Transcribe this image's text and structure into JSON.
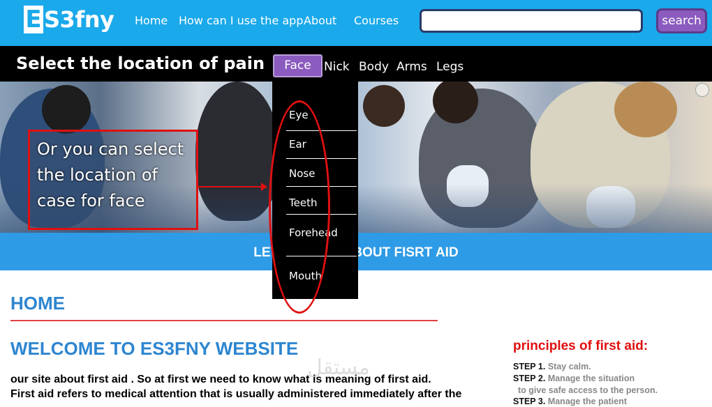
{
  "header": {
    "logo_e": "E",
    "logo_rest": "S3fny",
    "nav": [
      "Home",
      "How can I use the app",
      "About",
      "Courses"
    ],
    "search_value": "",
    "search_button": "search"
  },
  "location_bar": {
    "title": "Select the location of pain",
    "tabs": [
      "Face",
      "Nick",
      "Body",
      "Arms",
      "Legs"
    ],
    "selected_tab": "Face"
  },
  "dropdown": {
    "items": [
      "Eye",
      "Ear",
      "Nose",
      "Teeth",
      "Forehead",
      "Mouth"
    ]
  },
  "annotation": {
    "text": "Or you can select the location of case for face"
  },
  "banner": {
    "text": "LET'S LEARN ABOUT FISRT AID"
  },
  "main": {
    "home_heading": "HOME",
    "welcome_heading": "WELCOME TO ES3FNY WEBSITE",
    "paragraph_lines": [
      "our site about first aid . So at first we need to know what is meaning of first aid.",
      "First aid refers to medical attention that is usually administered immediately after the"
    ]
  },
  "sidebar": {
    "title": "principles of first aid:",
    "steps": [
      {
        "label": "STEP 1.",
        "text": "Stay calm."
      },
      {
        "label": "STEP 2.",
        "text": "Manage the situation"
      },
      {
        "label": "",
        "text": "to give safe access to the person."
      },
      {
        "label": "STEP 3.",
        "text": "Manage the patient"
      }
    ]
  },
  "watermark": "مستقل",
  "colors": {
    "topbar": "#1aa9ea",
    "accent_purple": "#8b5bbf",
    "heading_blue": "#2e86d0",
    "annotation_red": "#e01010"
  }
}
